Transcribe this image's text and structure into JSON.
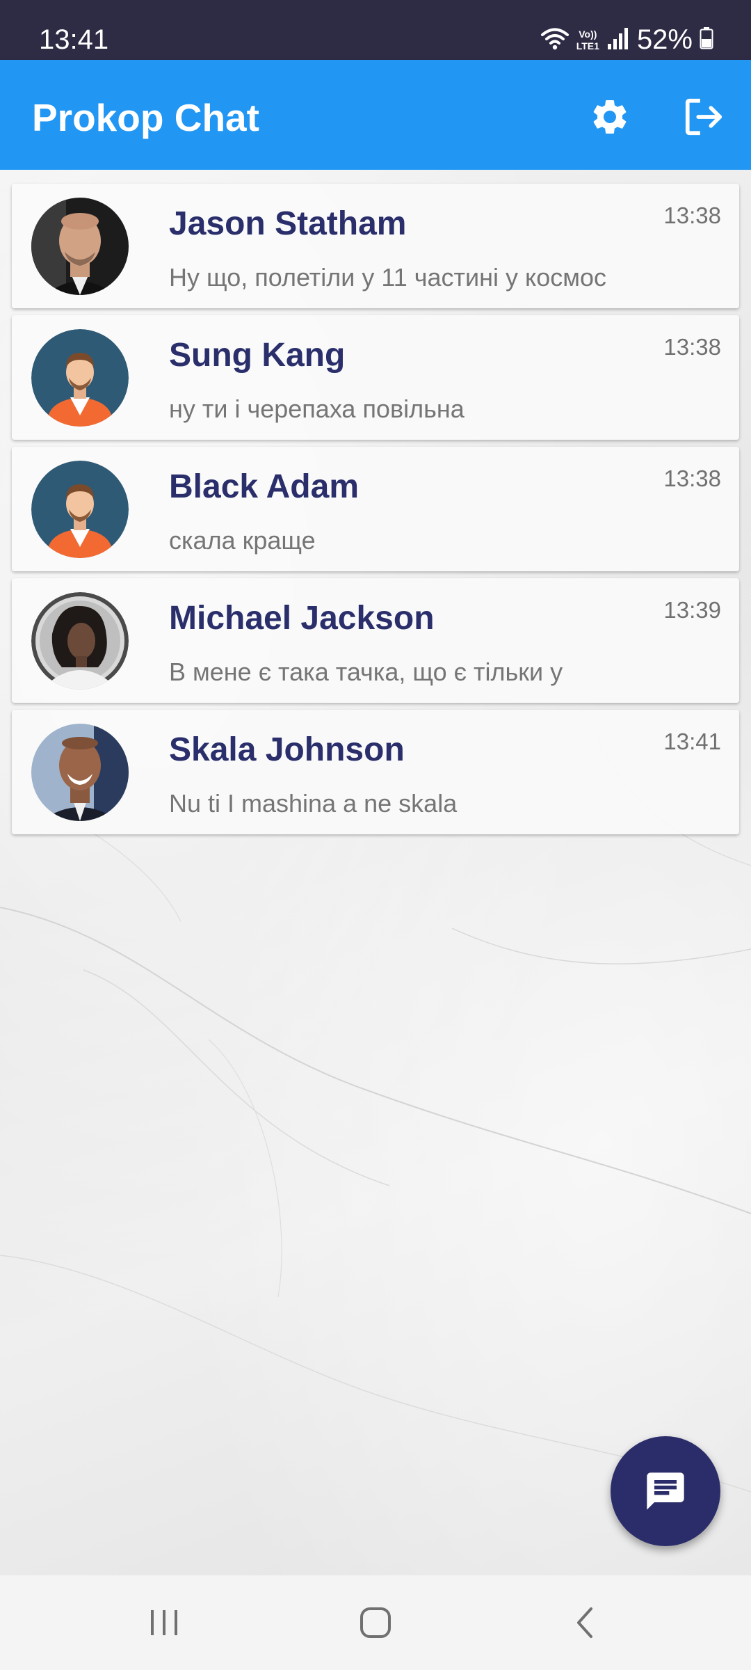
{
  "status_bar": {
    "time": "13:41",
    "volte_line1": "Vo))",
    "volte_line2": "LTE1",
    "battery_text": "52%",
    "icons": [
      "wifi-icon",
      "volte-icon",
      "signal-icon",
      "battery-icon"
    ]
  },
  "app_bar": {
    "title": "Prokop Chat",
    "actions": [
      {
        "name": "settings",
        "icon": "gear-icon"
      },
      {
        "name": "logout",
        "icon": "logout-icon"
      }
    ],
    "color": "#2196f3"
  },
  "chats": [
    {
      "name": "Jason Statham",
      "time": "13:38",
      "message": "Ну що, полетіли у 11 частині у космос",
      "avatar": "photo-bald-man"
    },
    {
      "name": "Sung Kang",
      "time": "13:38",
      "message": "ну ти і черепаха повільна",
      "avatar": "default-avatar"
    },
    {
      "name": "Black Adam",
      "time": "13:38",
      "message": "скала краще",
      "avatar": "default-avatar"
    },
    {
      "name": "Michael Jackson",
      "time": "13:39",
      "message": "В мене є така тачка, що є тільки у",
      "avatar": "photo-curly-hair"
    },
    {
      "name": "Skala Johnson",
      "time": "13:41",
      "message": "Nu ti I mashina a ne skala",
      "avatar": "photo-smiling-man"
    }
  ],
  "fab": {
    "icon": "chat-icon",
    "color": "#2a2d69"
  },
  "nav_bar": {
    "buttons": [
      {
        "name": "recents",
        "icon": "recents-icon"
      },
      {
        "name": "home",
        "icon": "home-icon"
      },
      {
        "name": "back",
        "icon": "back-icon"
      }
    ]
  },
  "colors": {
    "status_bar": "#2e2b44",
    "name_text": "#2a2f6c",
    "message_text": "#757575",
    "time_text": "#707070"
  }
}
